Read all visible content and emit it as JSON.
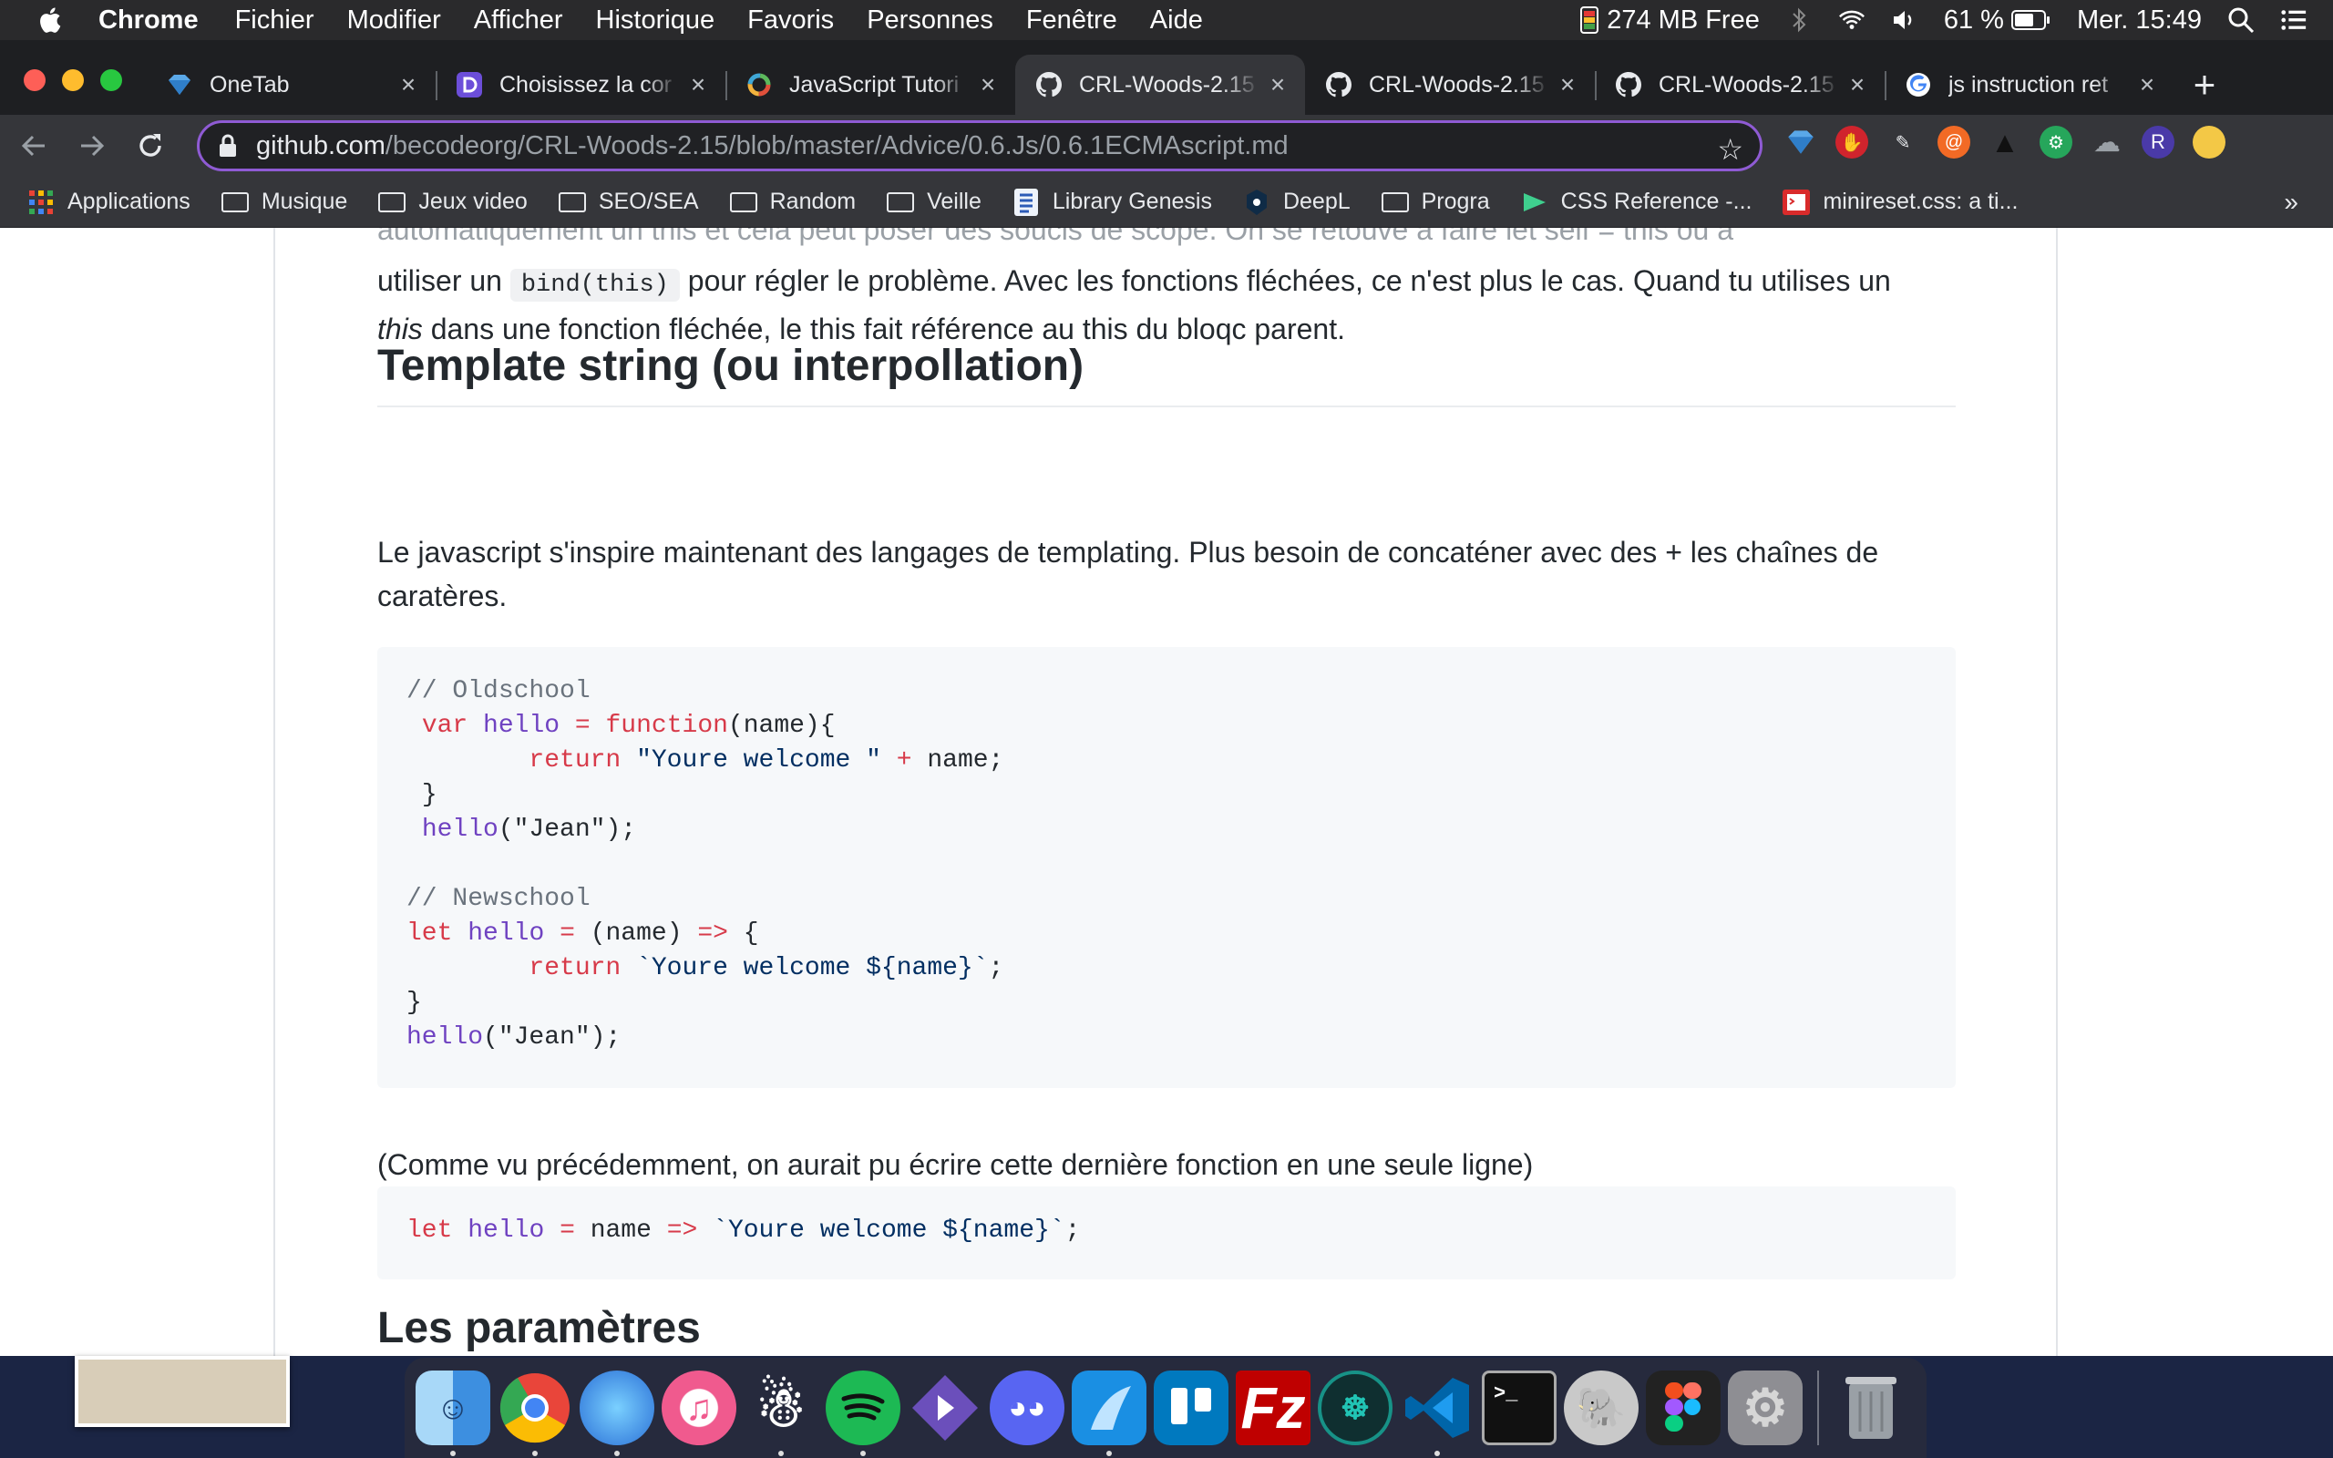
{
  "menubar": {
    "app": "Chrome",
    "items": [
      "Fichier",
      "Modifier",
      "Afficher",
      "Historique",
      "Favoris",
      "Personnes",
      "Fenêtre",
      "Aide"
    ],
    "memory": "274 MB Free",
    "battery": "61 %",
    "clock": "Mer. 15:49"
  },
  "tabs": [
    {
      "title": "OneTab",
      "icon": "onetab-icon",
      "color": "#4ea3e0"
    },
    {
      "title": "Choisissez la cor",
      "icon": "purple-d-icon",
      "color": "#6c4ed9"
    },
    {
      "title": "JavaScript Tutori",
      "icon": "colorful-ring-icon",
      "color": "#e0503b"
    },
    {
      "title": "CRL-Woods-2.15",
      "icon": "github-icon",
      "color": "#ffffff"
    },
    {
      "title": "CRL-Woods-2.15",
      "icon": "github-icon",
      "color": "#ffffff"
    },
    {
      "title": "CRL-Woods-2.15",
      "icon": "github-icon",
      "color": "#ffffff"
    },
    {
      "title": "js instruction ret",
      "icon": "google-icon",
      "color": "#4285f4"
    }
  ],
  "address": {
    "host": "github.com",
    "path": "/becodeorg/CRL-Woods-2.15/blob/master/Advice/0.6.Js/0.6.1ECMAscript.md"
  },
  "bookmarks": [
    {
      "label": "Applications",
      "kind": "apps-grid-icon"
    },
    {
      "label": "Musique",
      "kind": "folder-icon"
    },
    {
      "label": "Jeux video",
      "kind": "folder-icon"
    },
    {
      "label": "SEO/SEA",
      "kind": "folder-icon"
    },
    {
      "label": "Random",
      "kind": "folder-icon"
    },
    {
      "label": "Veille",
      "kind": "folder-icon"
    },
    {
      "label": "Library Genesis",
      "kind": "library-icon"
    },
    {
      "label": "DeepL",
      "kind": "deepl-icon"
    },
    {
      "label": "Progra",
      "kind": "folder-icon"
    },
    {
      "label": "CSS Reference -...",
      "kind": "css-icon"
    },
    {
      "label": "minireset.css: a ti...",
      "kind": "minireset-icon"
    }
  ],
  "content": {
    "partial_line_top": "automatiquement un this et cela peut poser des soucis de scope. On se retouve à faire let self = this ou à",
    "para1_a": "utiliser un ",
    "para1_code": "bind(this)",
    "para1_b": " pour régler le problème. Avec les fonctions fléchées, ce n'est plus le cas. Quand tu utilises un",
    "para1_c_em": "this",
    "para1_c": " dans une fonction fléchée, le this fait référence au this du bloqc parent.",
    "h2_template": "Template string (ou interpollation)",
    "para2": "Le javascript s'inspire maintenant des langages de templating. Plus besoin de concaténer avec des + les chaînes de caratères.",
    "para3": "(Comme vu précédemment, on aurait pu écrire cette dernière fonction en une seule ligne)",
    "h2_params": "Les paramètres",
    "code1": {
      "comment_old": "// Oldschool",
      "var": "var",
      "hello": "hello",
      "eq": "=",
      "function": "function",
      "sig": "(name){",
      "return": "return",
      "str_old": "\"Youre welcome \"",
      "plus": "+",
      "name_semi": "name;",
      "close": "}",
      "call_fn": "hello",
      "call_args": "(\"Jean\");",
      "comment_new": "// Newschool",
      "let": "let",
      "params": "(name)",
      "arrow": "=>",
      "open": "{",
      "tpl": "`Youre welcome ${name}`",
      "semi": ";"
    },
    "code2": {
      "let": "let",
      "hello": "hello",
      "eq": "=",
      "name": "name",
      "arrow": "=>",
      "tpl": "`Youre welcome ${name}`",
      "semi": ";"
    }
  },
  "dock": [
    {
      "name": "finder-icon",
      "color": "#3d9be9"
    },
    {
      "name": "chrome-icon",
      "color": "#e9453a"
    },
    {
      "name": "firefox-icon",
      "color": "#2a6fd6"
    },
    {
      "name": "itunes-icon",
      "color": "#f05a8e"
    },
    {
      "name": "cleaner-icon",
      "color": "#ffffff"
    },
    {
      "name": "spotify-icon",
      "color": "#1db954"
    },
    {
      "name": "app-triangle-icon",
      "color": "#6b4fbb"
    },
    {
      "name": "discord-icon",
      "color": "#5865f2"
    },
    {
      "name": "app-sail-icon",
      "color": "#1a8fe3"
    },
    {
      "name": "trello-icon",
      "color": "#0079bf"
    },
    {
      "name": "filezilla-icon",
      "color": "#bf0000"
    },
    {
      "name": "gitkraken-icon",
      "color": "#179287"
    },
    {
      "name": "vscode-icon",
      "color": "#0065a9"
    },
    {
      "name": "terminal-icon",
      "color": "#111111"
    },
    {
      "name": "tableplus-icon",
      "color": "#c9c9c9"
    },
    {
      "name": "figma-icon",
      "color": "#222222"
    },
    {
      "name": "system-preferences-icon",
      "color": "#8e8e93"
    },
    {
      "name": "trash-icon",
      "color": "#9aa0a6"
    }
  ]
}
